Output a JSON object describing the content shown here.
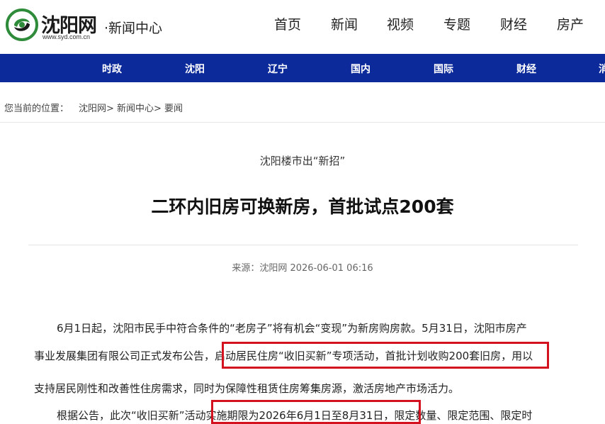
{
  "site": {
    "logo_text": "沈阳网",
    "logo_url": "www.syd.com.cn",
    "section_name": "·新闻中心"
  },
  "top_nav": [
    "首页",
    "新闻",
    "视频",
    "专题",
    "财经",
    "房产"
  ],
  "sub_nav": [
    "时政",
    "沈阳",
    "辽宁",
    "国内",
    "国际",
    "财经",
    "消"
  ],
  "breadcrumb": {
    "label": "您当前的位置：",
    "path": "沈阳网> 新闻中心> 要闻"
  },
  "article": {
    "subtitle": "沈阳楼市出“新招”",
    "title": "二环内旧房可换新房，首批试点200套",
    "meta": "来源：沈阳网 2026-06-01 06:16",
    "lines": [
      "6月1日起，沈阳市民手中符合条件的“老房子”将有机会“变现”为新房购房款。5月31日，沈阳市房产",
      "事业发展集团有限公司正式发布公告，启动居民住房“收旧买新”专项活动，首批计划收购200套旧房，用以",
      "支持居民刚性和改善性住房需求，同时为保障性租赁住房筹集房源，激活房地产市场活力。",
      "根据公告，此次“收旧买新”活动实施期限为2026年6月1日至8月31日，限定数量、限定范围、限定时"
    ]
  },
  "colors": {
    "nav_blue": "#0d2a9a",
    "highlight_red": "#d4121f",
    "logo_green": "#2e8b3a"
  }
}
